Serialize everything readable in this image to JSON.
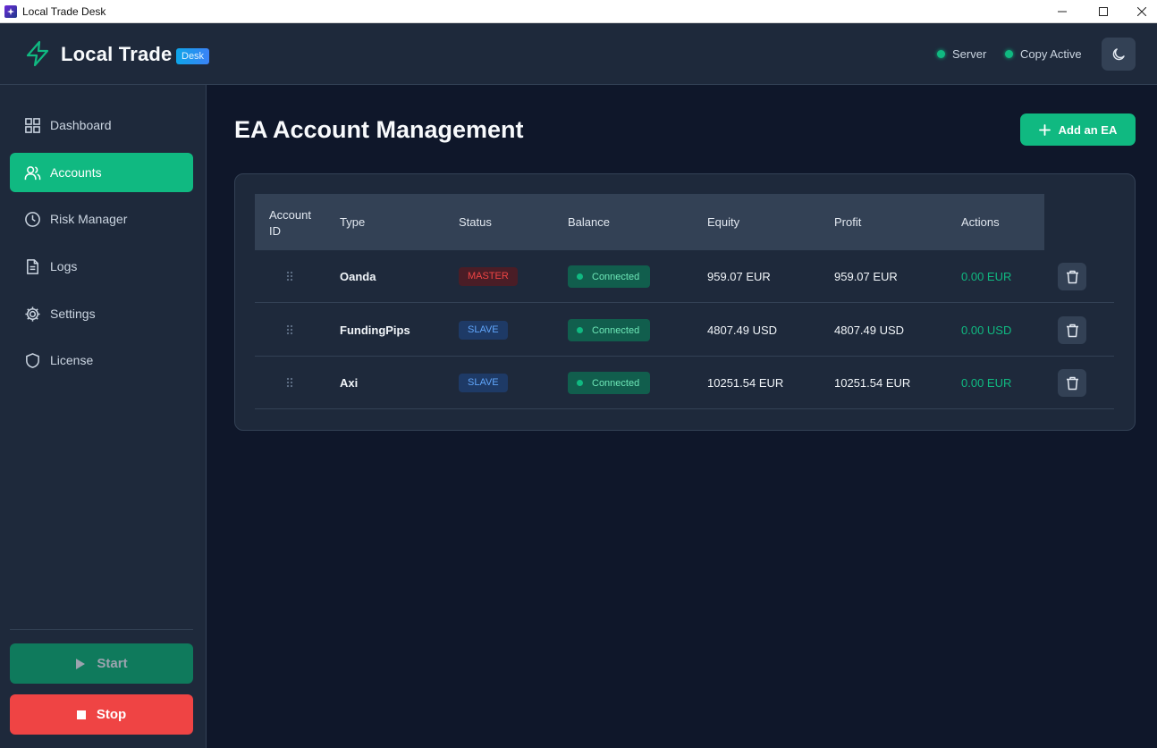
{
  "window": {
    "title": "Local Trade Desk"
  },
  "header": {
    "brand": "Local Trade",
    "badge": "Desk",
    "status_server": "Server",
    "status_copy": "Copy Active"
  },
  "sidebar": {
    "items": [
      {
        "label": "Dashboard",
        "icon": "grid-icon"
      },
      {
        "label": "Accounts",
        "icon": "users-icon"
      },
      {
        "label": "Risk Manager",
        "icon": "clock-icon"
      },
      {
        "label": "Logs",
        "icon": "file-icon"
      },
      {
        "label": "Settings",
        "icon": "gear-icon"
      },
      {
        "label": "License",
        "icon": "shield-icon"
      }
    ],
    "active": "Accounts",
    "start_label": "Start",
    "stop_label": "Stop"
  },
  "main": {
    "title": "EA Account Management",
    "add_label": "Add an EA"
  },
  "table": {
    "headers": {
      "account_id_1": "Account",
      "account_id_2": "ID",
      "type": "Type",
      "status": "Status",
      "balance": "Balance",
      "equity": "Equity",
      "profit": "Profit",
      "actions": "Actions"
    },
    "rows": [
      {
        "name": "Oanda",
        "type": "MASTER",
        "status": "Connected",
        "balance": "959.07 EUR",
        "equity": "959.07 EUR",
        "profit": "0.00 EUR"
      },
      {
        "name": "FundingPips",
        "type": "SLAVE",
        "status": "Connected",
        "balance": "4807.49 USD",
        "equity": "4807.49 USD",
        "profit": "0.00 USD"
      },
      {
        "name": "Axi",
        "type": "SLAVE",
        "status": "Connected",
        "balance": "10251.54 EUR",
        "equity": "10251.54 EUR",
        "profit": "0.00 EUR"
      }
    ]
  },
  "colors": {
    "accent": "#10b981",
    "danger": "#ef4444",
    "background": "#0f172a",
    "panel": "#1e293b"
  }
}
